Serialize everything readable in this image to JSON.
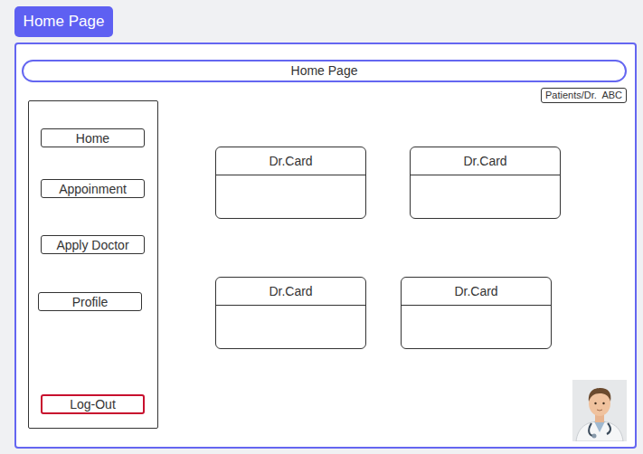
{
  "page_tag": "Home Page",
  "header": {
    "title": "Home Page"
  },
  "user_badge": "Patients/Dr.  ABC",
  "sidebar": {
    "items": [
      {
        "label": "Home",
        "kind": "nav"
      },
      {
        "label": "Appoinment",
        "kind": "nav"
      },
      {
        "label": "Apply Doctor",
        "kind": "nav"
      },
      {
        "label": "Profile",
        "kind": "nav"
      },
      {
        "label": "Log-Out",
        "kind": "logout"
      }
    ]
  },
  "cards": [
    [
      {
        "title": "Dr.Card"
      },
      {
        "title": "Dr.Card"
      }
    ],
    [
      {
        "title": "Dr.Card"
      },
      {
        "title": "Dr.Card"
      }
    ]
  ]
}
